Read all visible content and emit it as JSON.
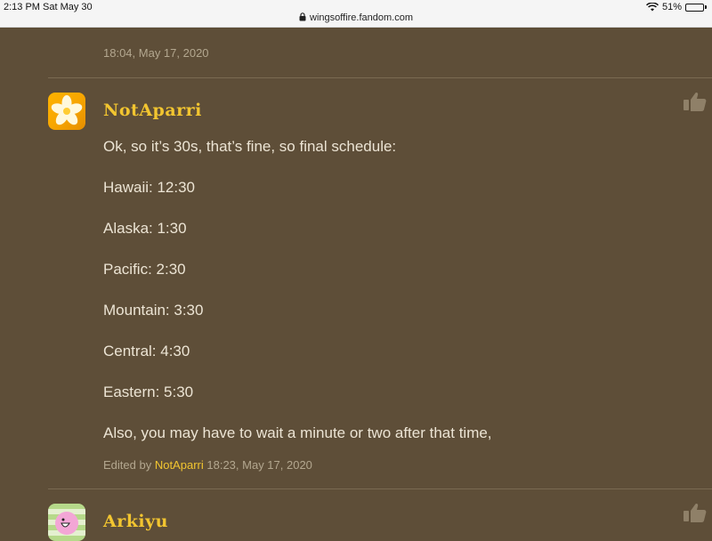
{
  "status_bar": {
    "time": "2:13 PM",
    "date": "Sat May 30",
    "battery": "51%",
    "battery_level": 0.51,
    "url": "wingsoffire.fandom.com"
  },
  "top_timestamp": "18:04, May 17, 2020",
  "comments": [
    {
      "username": "NotAparri",
      "lines": [
        "Ok, so it’s 30s, that’s fine, so final schedule:",
        "Hawaii: 12:30",
        "Alaska: 1:30",
        "Pacific: 2:30",
        "Mountain: 3:30",
        "Central: 4:30",
        "Eastern: 5:30",
        "Also, you may have to wait a minute or two after that time,"
      ],
      "edited_prefix": "Edited by",
      "edited_user": "NotAparri",
      "edited_time": "18:23, May 17, 2020"
    },
    {
      "username": "Arkiyu"
    }
  ],
  "icons": {
    "like": "thumbs-up-icon",
    "lock": "lock-icon",
    "wifi": "wifi-icon",
    "battery": "battery-icon"
  },
  "colors": {
    "background": "#5e4e38",
    "username": "#f2c530",
    "body_text": "#ece4d4",
    "meta_text": "#b3a78f"
  }
}
